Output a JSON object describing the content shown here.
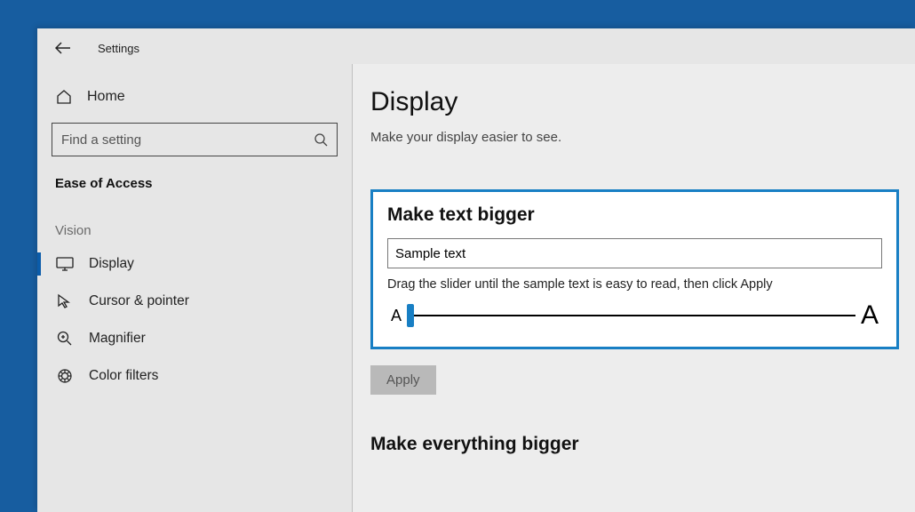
{
  "titlebar": {
    "title": "Settings"
  },
  "sidebar": {
    "home_label": "Home",
    "search_placeholder": "Find a setting",
    "section_label": "Ease of Access",
    "group_label": "Vision",
    "items": [
      {
        "label": "Display"
      },
      {
        "label": "Cursor & pointer"
      },
      {
        "label": "Magnifier"
      },
      {
        "label": "Color filters"
      }
    ]
  },
  "content": {
    "page_title": "Display",
    "page_subtitle": "Make your display easier to see.",
    "make_text_bigger": {
      "title": "Make text bigger",
      "sample_value": "Sample text",
      "instruction": "Drag the slider until the sample text is easy to read, then click Apply",
      "small_a": "A",
      "big_a": "A",
      "apply_label": "Apply"
    },
    "make_everything_bigger_title": "Make everything bigger"
  }
}
